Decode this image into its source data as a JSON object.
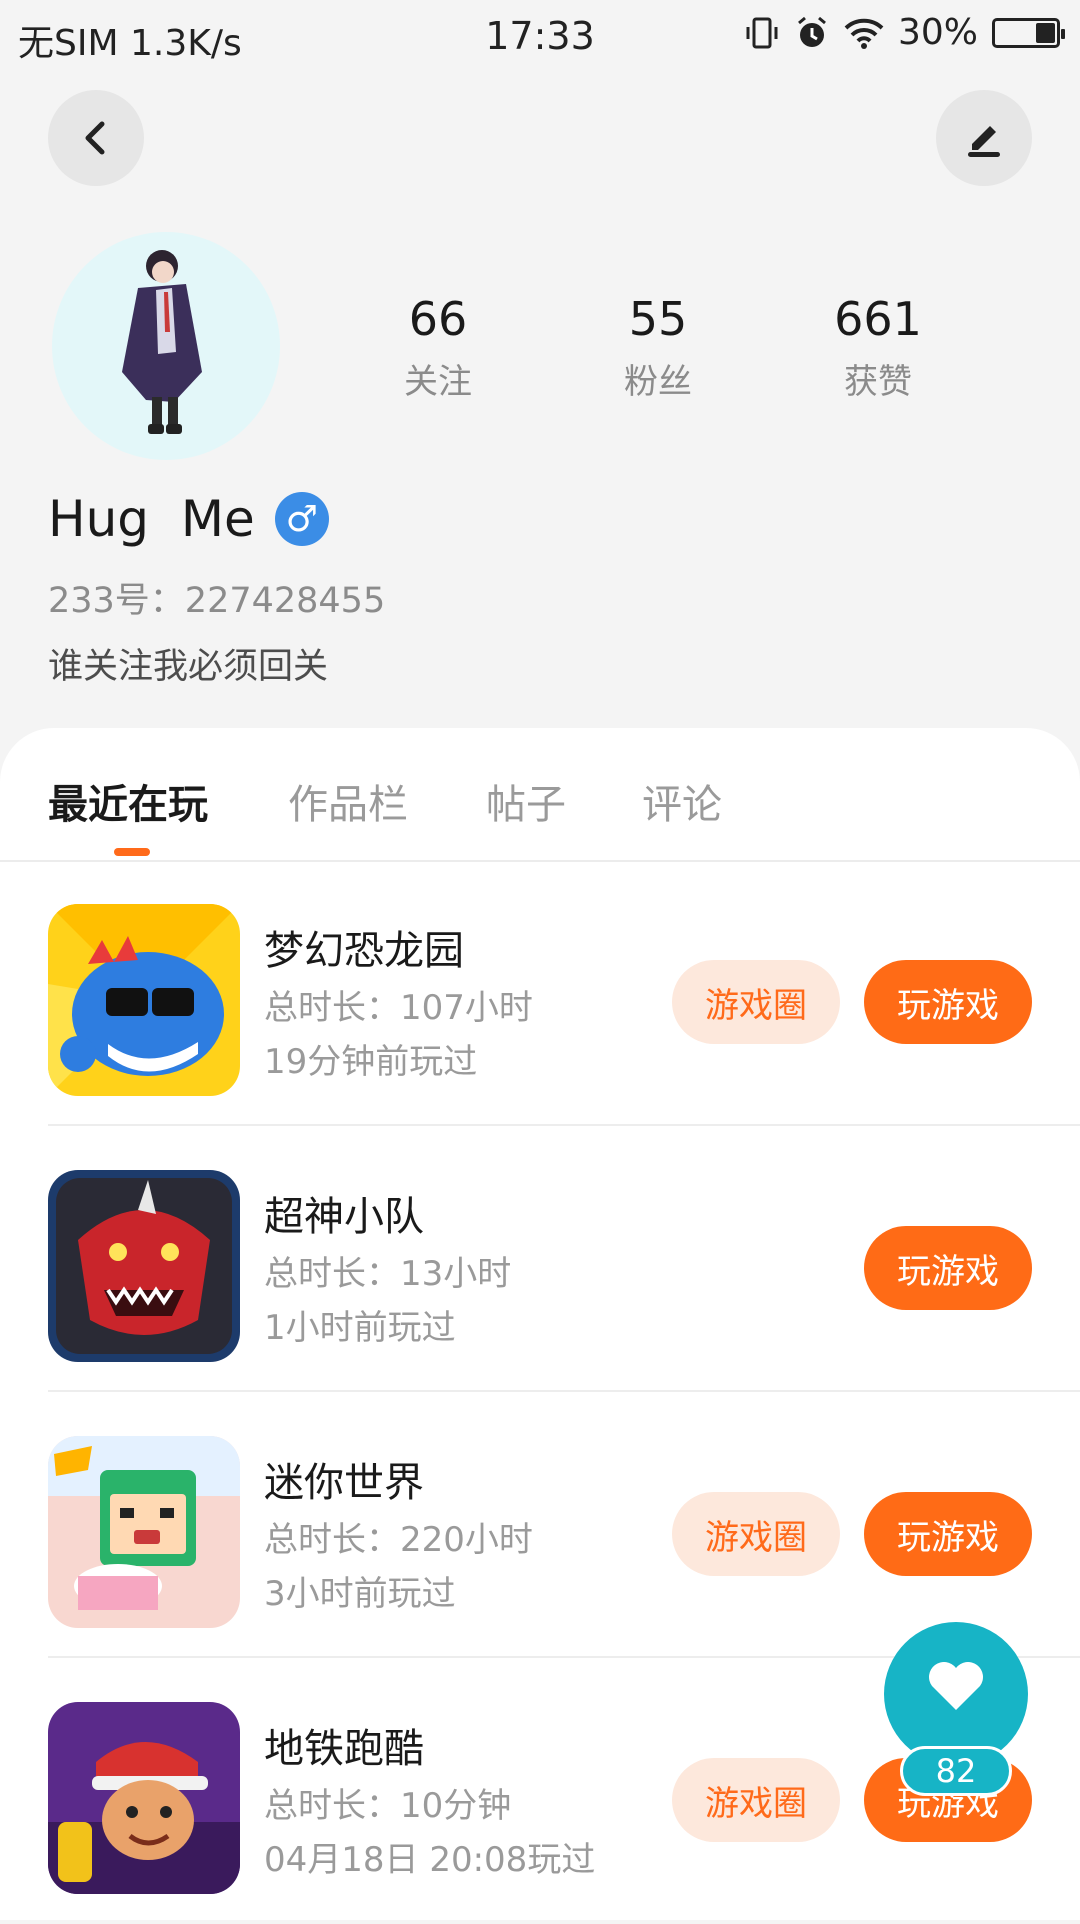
{
  "status_bar": {
    "carrier": "无SIM",
    "speed": "1.3K/s",
    "time": "17:33",
    "battery": "30%",
    "battery_level": 0.3
  },
  "profile": {
    "stats": [
      {
        "num": "66",
        "label": "关注"
      },
      {
        "num": "55",
        "label": "粉丝"
      },
      {
        "num": "661",
        "label": "获赞"
      }
    ],
    "name": "Hug  Me",
    "gender_symbol": "♂",
    "uid": "233号：227428455",
    "bio": "谁关注我必须回关"
  },
  "tabs": [
    "最近在玩",
    "作品栏",
    "帖子",
    "评论"
  ],
  "games": [
    {
      "title": "梦幻恐龙园",
      "duration": "总时长：107小时",
      "last_played": "19分钟前玩过",
      "circle_label": "游戏圈",
      "play_label": "玩游戏"
    },
    {
      "title": "超神小队",
      "duration": "总时长：13小时",
      "last_played": "1小时前玩过",
      "play_label": "玩游戏"
    },
    {
      "title": "迷你世界",
      "duration": "总时长：220小时",
      "last_played": "3小时前玩过",
      "circle_label": "游戏圈",
      "play_label": "玩游戏"
    },
    {
      "title": "地铁跑酷",
      "duration": "总时长：10分钟",
      "last_played": "04月18日 20:08玩过",
      "circle_label": "游戏圈",
      "play_label": "玩游戏"
    }
  ],
  "like_fab": {
    "count": "82"
  },
  "colors": {
    "accent": "#ff6b16",
    "accent_soft": "#fde8dc",
    "fab": "#17b4c6",
    "gender": "#3b8de6"
  }
}
